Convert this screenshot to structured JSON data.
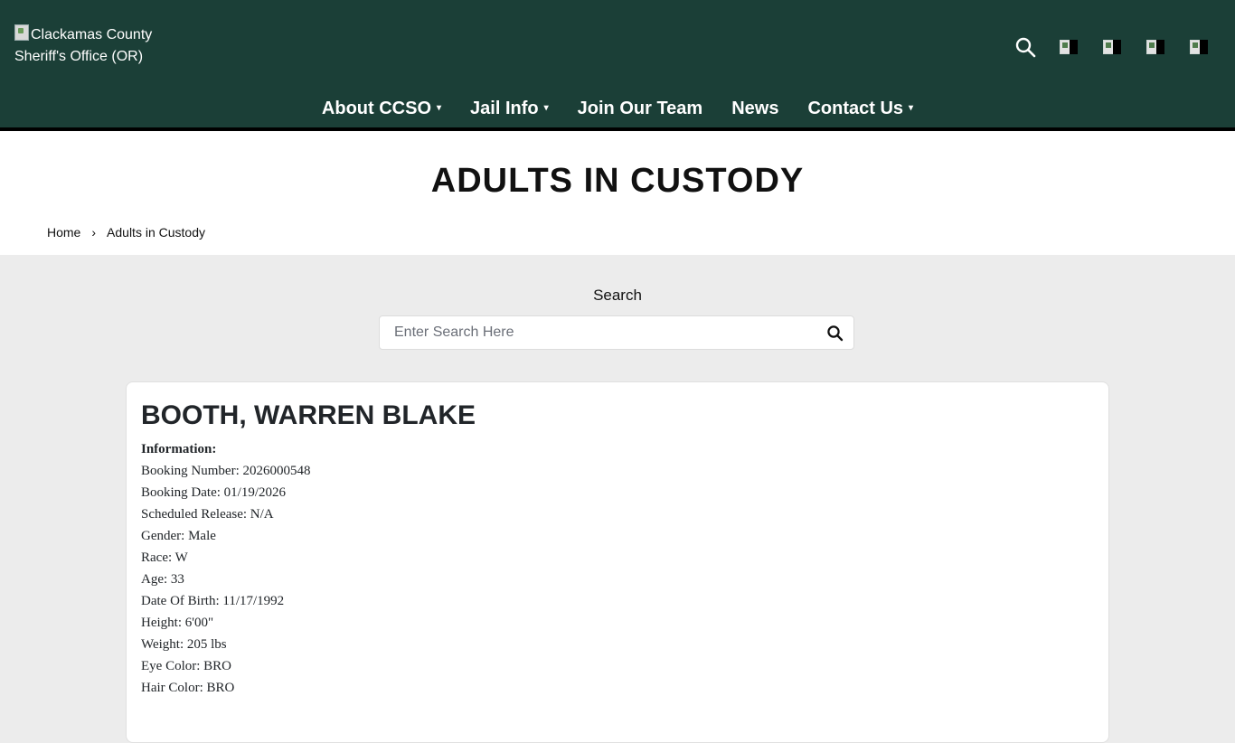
{
  "header": {
    "logo_alt_line1": "Clackamas County",
    "logo_alt_line2": "Sheriff's Office (OR)",
    "icons": [
      "search-icon",
      "facebook-icon",
      "twitter-icon",
      "instagram-icon",
      "youtube-icon"
    ],
    "nav": [
      {
        "label": "About CCSO",
        "has_dropdown": true
      },
      {
        "label": "Jail Info",
        "has_dropdown": true
      },
      {
        "label": "Join Our Team",
        "has_dropdown": false
      },
      {
        "label": "News",
        "has_dropdown": false
      },
      {
        "label": "Contact Us",
        "has_dropdown": true
      }
    ],
    "caret": "▾"
  },
  "page": {
    "title": "ADULTS IN CUSTODY",
    "breadcrumb": {
      "home": "Home",
      "separator": "›",
      "current": "Adults in Custody"
    }
  },
  "search": {
    "label": "Search",
    "placeholder": "Enter Search Here"
  },
  "inmate": {
    "name": "BOOTH, WARREN BLAKE",
    "info_heading": "Information:",
    "fields": [
      {
        "label": "Booking Number",
        "value": "2026000548"
      },
      {
        "label": "Booking Date",
        "value": "01/19/2026"
      },
      {
        "label": "Scheduled Release",
        "value": "N/A"
      },
      {
        "label": "Gender",
        "value": "Male"
      },
      {
        "label": "Race",
        "value": "W"
      },
      {
        "label": "Age",
        "value": "33"
      },
      {
        "label": "Date Of Birth",
        "value": "11/17/1992"
      },
      {
        "label": "Height",
        "value": "6'00\""
      },
      {
        "label": "Weight",
        "value": "205 lbs"
      },
      {
        "label": "Eye Color",
        "value": "BRO"
      },
      {
        "label": "Hair Color",
        "value": "BRO"
      }
    ]
  },
  "colors": {
    "header_bg": "#1b3f37",
    "page_bg": "#ececec",
    "text_dark": "#212529"
  }
}
